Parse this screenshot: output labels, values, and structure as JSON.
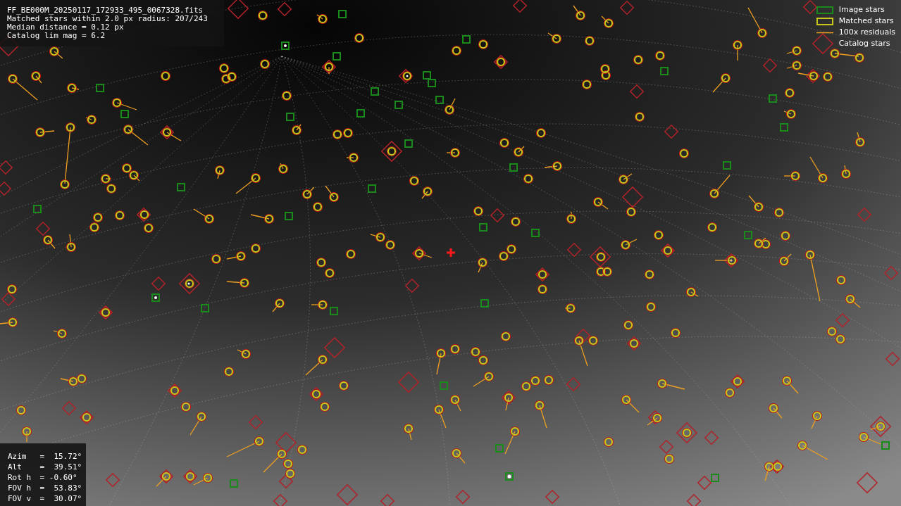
{
  "info_panel": {
    "lines": [
      "FF_BE000M_20250117_172933_495_0067328.fits",
      "Matched stars within 2.0 px radius: 207/243",
      "Median distance = 0.12 px",
      "Catalog lim mag = 6.2"
    ]
  },
  "legend": [
    {
      "label": "Image stars"
    },
    {
      "kind": "matched",
      "label": "Matched stars"
    },
    {
      "kind": "residual",
      "label": "100x residuals"
    },
    {
      "kind": "catalog",
      "label": "Catalog stars"
    }
  ],
  "pointing": [
    {
      "name": "Azim",
      "value": "=  15.72°"
    },
    {
      "name": "Alt",
      "value": "=  39.51°"
    },
    {
      "name": "Rot h",
      "value": "= -0.60°"
    },
    {
      "name": "FOV h",
      "value": "=  53.83°"
    },
    {
      "name": "FOV v",
      "value": "=  30.07°"
    }
  ]
}
